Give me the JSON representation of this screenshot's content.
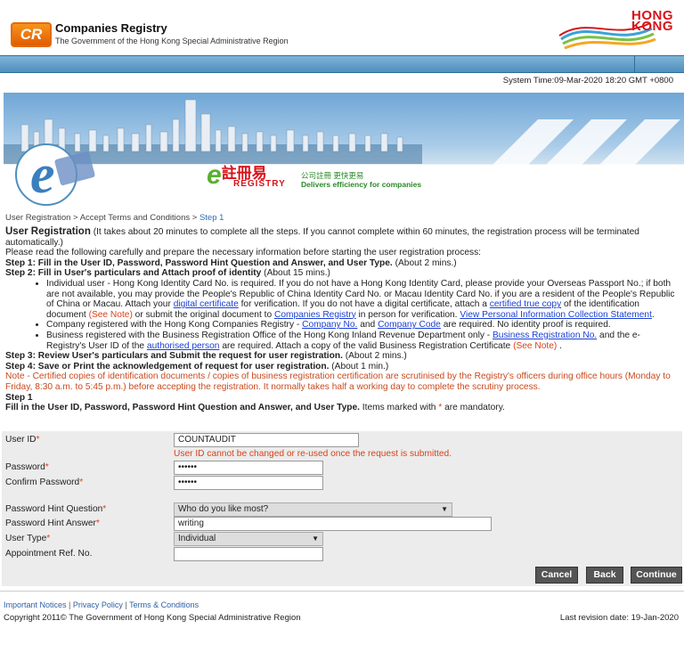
{
  "header": {
    "logo_text": "CR",
    "org_name": "Companies Registry",
    "org_sub": "The Government of the Hong Kong Special Administrative Region",
    "hk_brand_line1": "HONG",
    "hk_brand_line2": "KONG"
  },
  "system_time": "System Time:09-Mar-2020 18:20 GMT +0800",
  "banner": {
    "chinese": "註冊易",
    "english": "REGISTRY",
    "tag_cn": "公司註冊 更快更易",
    "tag_en": "Delivers efficiency for companies"
  },
  "breadcrumb": {
    "items": [
      "User Registration",
      ">",
      "Accept Terms and Conditions",
      ">"
    ],
    "current": "Step 1"
  },
  "intro": {
    "title": "User Registration",
    "title_rest": " (It takes about 20 minutes to complete all the steps. If you cannot complete within 60 minutes, the registration process will be terminated automatically.)",
    "read": "Please read the following carefully and prepare the necessary information before starting the user registration process:",
    "step1_b": "Step 1: Fill in the User ID, Password, Password Hint Question and Answer, and User Type.",
    "step1_t": " (About 2 mins.)",
    "step2_b": "Step 2: Fill in User's particulars and Attach proof of identity",
    "step2_t": " (About 15 mins.)",
    "b1_a": "Individual user - Hong Kong Identity Card No. is required. If you do not have a Hong Kong Identity Card, please provide your Overseas Passport No.; if both are not available, you may provide the People's Republic of China Identity Card No. or Macau Identity Card No. if you are a resident of the People's Republic of China or Macau. Attach your ",
    "b1_link1": "digital certificate",
    "b1_b": " for verification. If you do not have a digital certificate, attach a ",
    "b1_link2": "certified true copy",
    "b1_c": " of the identification document ",
    "b1_note": "(See Note)",
    "b1_d": " or submit the original document to ",
    "b1_link3": "Companies Registry",
    "b1_e": " in person for verification. ",
    "b1_link4": "View Personal Information Collection Statement",
    "b1_f": ".",
    "b2_a": "Company registered with the Hong Kong Companies Registry - ",
    "b2_link1": "Company No.",
    "b2_b": " and ",
    "b2_link2": "Company Code",
    "b2_c": " are required. No identity proof is required.",
    "b3_a": "Business registered with the Business Registration Office of the Hong Kong Inland Revenue Department only - ",
    "b3_link1": "Business Registration No.",
    "b3_b": " and the e-Registry's User ID of the ",
    "b3_link2": "authorised person",
    "b3_c": " are required. Attach a copy of the valid Business Registration Certificate ",
    "b3_note": "(See Note)",
    "b3_d": " .",
    "step3_b": "Step 3: Review User's particulars and Submit the request for user registration.",
    "step3_t": " (About 2 mins.)",
    "step4_b": "Step 4: Save or Print the acknowledgement of request for user registration.",
    "step4_t": " (About 1 min.)",
    "note": "Note - Certified copies of identification documents / copies of business registration certification are scrutinised by the Registry's officers during office hours (Monday to Friday, 8:30 a.m. to 5:45 p.m.) before accepting the registration. It normally takes half a working day to complete the scrutiny process.",
    "step_head": "Step 1",
    "fill_b": "Fill in the User ID, Password, Password Hint Question and Answer, and User Type.",
    "fill_t": " Items marked with ",
    "fill_star": "*",
    "fill_end": " are mandatory."
  },
  "form": {
    "user_id_label": "User ID",
    "user_id_value": "COUNTAUDIT",
    "user_id_warning": "User ID cannot be changed or re-used once the request is submitted.",
    "password_label": "Password",
    "password_value": "••••••",
    "confirm_label": "Confirm Password",
    "confirm_value": "••••••",
    "hint_q_label": "Password Hint Question",
    "hint_q_value": "Who do you like most?",
    "hint_a_label": "Password Hint Answer",
    "hint_a_value": "writing",
    "user_type_label": "User Type",
    "user_type_value": "Individual",
    "appt_label": "Appointment Ref. No.",
    "appt_value": "",
    "star": "*"
  },
  "buttons": {
    "cancel": "Cancel",
    "back": "Back",
    "continue": "Continue"
  },
  "footer": {
    "link1": "Important Notices",
    "link2": "Privacy Policy",
    "link3": "Terms & Conditions",
    "sep": "|",
    "copyright": "Copyright 2011© The Government of Hong Kong Special Administrative Region",
    "revision": "Last revision date: 19-Jan-2020"
  },
  "colors": {
    "accent_blue": "#4f8fbd",
    "mandatory_red": "#d9421a",
    "button_grey": "#555555",
    "link_blue": "#1a3fd4"
  }
}
